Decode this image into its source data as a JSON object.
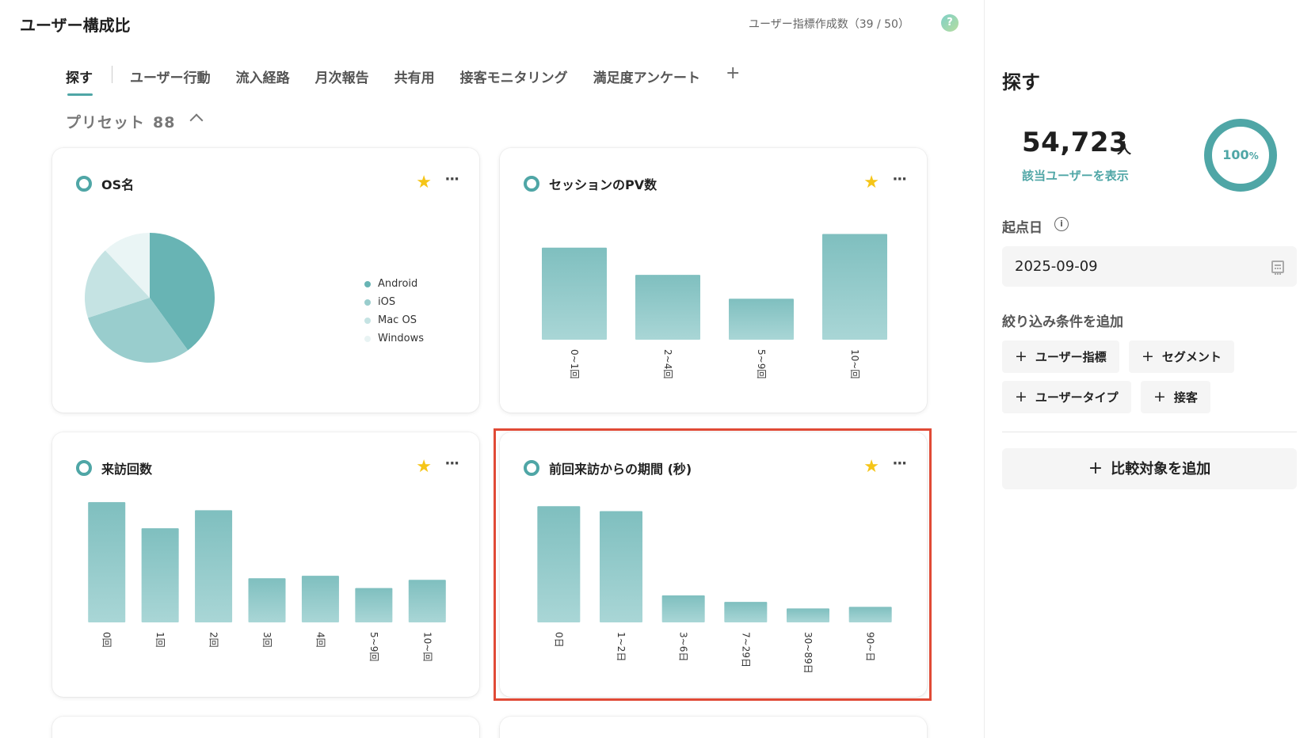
{
  "header": {
    "title": "ユーザー構成比",
    "usage_text": "ユーザー指標作成数（39 / 50）",
    "help_icon": "question-circle-icon"
  },
  "tabs": [
    {
      "label": "探す",
      "active": true
    },
    {
      "label": "ユーザー行動"
    },
    {
      "label": "流入経路"
    },
    {
      "label": "月次報告"
    },
    {
      "label": "共有用"
    },
    {
      "label": "接客モニタリング"
    },
    {
      "label": "満足度アンケート"
    }
  ],
  "tab_add": "+",
  "preset": {
    "label": "プリセット",
    "count": "88",
    "icon": "chevron-up-icon"
  },
  "colors": {
    "accent": "#4fa6a6",
    "bar_top": "#7fbfbf",
    "bar_bottom": "#a9d6d6",
    "star": "#f5c518",
    "highlight": "#e04a36"
  },
  "cards": [
    {
      "title": "OS名",
      "more": "···"
    },
    {
      "title": "セッションのPV数",
      "more": "···"
    },
    {
      "title": "来訪回数",
      "more": "···"
    },
    {
      "title": "前回来訪からの期間 (秒)",
      "more": "···"
    }
  ],
  "chart_data": [
    {
      "type": "pie",
      "title": "OS名",
      "categories": [
        "Android",
        "iOS",
        "Mac OS",
        "Windows"
      ],
      "values": [
        40,
        30,
        18,
        12
      ],
      "colors": [
        "#68b4b4",
        "#99cdcd",
        "#c5e3e3",
        "#eaf5f5"
      ],
      "legend": "right"
    },
    {
      "type": "bar",
      "title": "セッションのPV数",
      "categories": [
        "0~1回",
        "2~4回",
        "5~9回",
        "10~回"
      ],
      "values": [
        108,
        76,
        48,
        124
      ],
      "ylim": [
        0,
        130
      ]
    },
    {
      "type": "bar",
      "title": "来訪回数",
      "categories": [
        "0回",
        "1回",
        "2回",
        "3回",
        "4回",
        "5~9回",
        "10~回"
      ],
      "values": [
        147,
        115,
        137,
        54,
        57,
        42,
        52
      ],
      "ylim": [
        0,
        150
      ]
    },
    {
      "type": "bar",
      "title": "前回来訪からの期間 (秒)",
      "categories": [
        "0日",
        "1~2日",
        "3~6日",
        "7~29日",
        "30~89日",
        "90~日"
      ],
      "values": [
        142,
        136,
        33,
        25,
        17,
        19
      ],
      "ylim": [
        0,
        150
      ]
    }
  ],
  "side": {
    "title": "探す",
    "count": "54,723",
    "count_unit": "人",
    "show_users_link": "該当ユーザーを表示",
    "percent_value": "100",
    "percent_sign": "%",
    "start_date_label": "起点日",
    "start_date_value": "2025-09-09",
    "filter_label": "絞り込み条件を追加",
    "filter_chips": [
      "ユーザー指標",
      "セグメント",
      "ユーザータイプ",
      "接客"
    ],
    "compare_button": "比較対象を追加"
  }
}
